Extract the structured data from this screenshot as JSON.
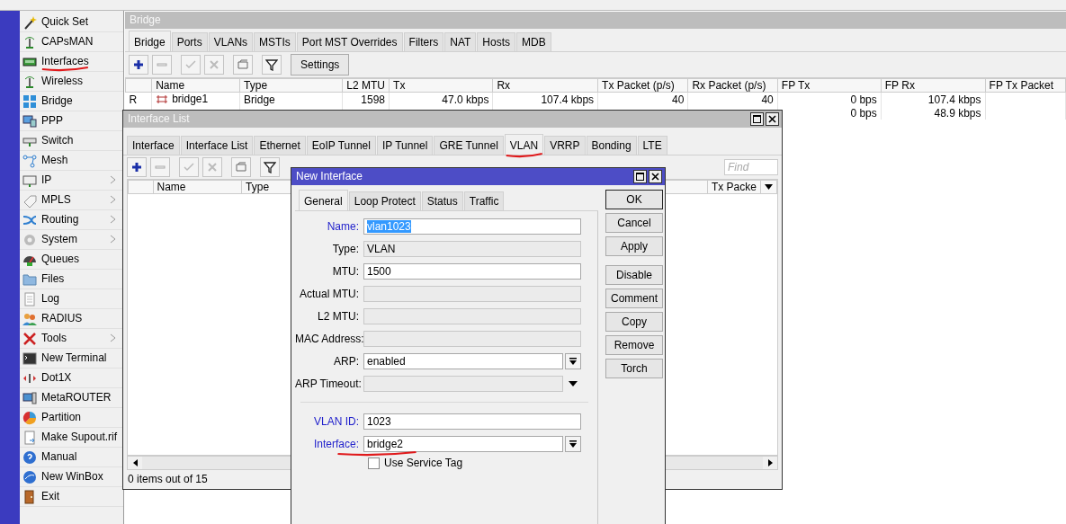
{
  "sidebar": {
    "items": [
      {
        "label": "Quick Set",
        "submenu": false,
        "annotated": false
      },
      {
        "label": "CAPsMAN",
        "submenu": false,
        "annotated": false
      },
      {
        "label": "Interfaces",
        "submenu": false,
        "annotated": true
      },
      {
        "label": "Wireless",
        "submenu": false,
        "annotated": false
      },
      {
        "label": "Bridge",
        "submenu": false,
        "annotated": false
      },
      {
        "label": "PPP",
        "submenu": false,
        "annotated": false
      },
      {
        "label": "Switch",
        "submenu": false,
        "annotated": false
      },
      {
        "label": "Mesh",
        "submenu": false,
        "annotated": false
      },
      {
        "label": "IP",
        "submenu": true,
        "annotated": false
      },
      {
        "label": "MPLS",
        "submenu": true,
        "annotated": false
      },
      {
        "label": "Routing",
        "submenu": true,
        "annotated": false
      },
      {
        "label": "System",
        "submenu": true,
        "annotated": false
      },
      {
        "label": "Queues",
        "submenu": false,
        "annotated": false
      },
      {
        "label": "Files",
        "submenu": false,
        "annotated": false
      },
      {
        "label": "Log",
        "submenu": false,
        "annotated": false
      },
      {
        "label": "RADIUS",
        "submenu": false,
        "annotated": false
      },
      {
        "label": "Tools",
        "submenu": true,
        "annotated": false
      },
      {
        "label": "New Terminal",
        "submenu": false,
        "annotated": false
      },
      {
        "label": "Dot1X",
        "submenu": false,
        "annotated": false
      },
      {
        "label": "MetaROUTER",
        "submenu": false,
        "annotated": false
      },
      {
        "label": "Partition",
        "submenu": false,
        "annotated": false
      },
      {
        "label": "Make Supout.rif",
        "submenu": false,
        "annotated": false
      },
      {
        "label": "Manual",
        "submenu": false,
        "annotated": false
      },
      {
        "label": "New WinBox",
        "submenu": false,
        "annotated": false
      },
      {
        "label": "Exit",
        "submenu": false,
        "annotated": false
      }
    ]
  },
  "bridge_window": {
    "title": "Bridge",
    "tabs": [
      {
        "label": "Bridge",
        "selected": true,
        "annotated": false
      },
      {
        "label": "Ports",
        "selected": false,
        "annotated": false
      },
      {
        "label": "VLANs",
        "selected": false,
        "annotated": false
      },
      {
        "label": "MSTIs",
        "selected": false,
        "annotated": false
      },
      {
        "label": "Port MST Overrides",
        "selected": false,
        "annotated": false
      },
      {
        "label": "Filters",
        "selected": false,
        "annotated": false
      },
      {
        "label": "NAT",
        "selected": false,
        "annotated": false
      },
      {
        "label": "Hosts",
        "selected": false,
        "annotated": false
      },
      {
        "label": "MDB",
        "selected": false,
        "annotated": false
      }
    ],
    "settings_button": "Settings",
    "table": {
      "columns": [
        "Name",
        "Type",
        "L2 MTU",
        "Tx",
        "Rx",
        "Tx Packet (p/s)",
        "Rx Packet (p/s)",
        "FP Tx",
        "FP Rx",
        "FP Tx Packet"
      ],
      "rows": [
        {
          "flag": "R",
          "cells": [
            "bridge1",
            "Bridge",
            "1598",
            "47.0 kbps",
            "107.4 kbps",
            "40",
            "40",
            "0 bps",
            "107.4 kbps",
            null
          ]
        },
        {
          "flag": null,
          "cells": [
            null,
            null,
            null,
            null,
            null,
            null,
            null,
            "0 bps",
            "48.9 kbps",
            null
          ]
        }
      ]
    }
  },
  "interface_list_window": {
    "title": "Interface List",
    "tabs": [
      {
        "label": "Interface",
        "selected": false,
        "annotated": false
      },
      {
        "label": "Interface List",
        "selected": false,
        "annotated": false
      },
      {
        "label": "Ethernet",
        "selected": false,
        "annotated": false
      },
      {
        "label": "EoIP Tunnel",
        "selected": false,
        "annotated": false
      },
      {
        "label": "IP Tunnel",
        "selected": false,
        "annotated": false
      },
      {
        "label": "GRE Tunnel",
        "selected": false,
        "annotated": false
      },
      {
        "label": "VLAN",
        "selected": true,
        "annotated": true
      },
      {
        "label": "VRRP",
        "selected": false,
        "annotated": false
      },
      {
        "label": "Bonding",
        "selected": false,
        "annotated": false
      },
      {
        "label": "LTE",
        "selected": false,
        "annotated": false
      }
    ],
    "find": {
      "placeholder": "Find"
    },
    "table": {
      "columns": [
        "Name",
        "Type",
        "Tx Packe"
      ]
    },
    "status": "0 items out of 15"
  },
  "new_interface_window": {
    "title": "New Interface",
    "tabs": [
      {
        "label": "General",
        "selected": true
      },
      {
        "label": "Loop Protect",
        "selected": false
      },
      {
        "label": "Status",
        "selected": false
      },
      {
        "label": "Traffic",
        "selected": false
      }
    ],
    "fields": [
      {
        "kind": "text",
        "label": "Name:",
        "value": "vlan1023",
        "emphasized": true,
        "disabled": false,
        "value_selected": true,
        "annotated": false
      },
      {
        "kind": "text",
        "label": "Type:",
        "value": "VLAN",
        "emphasized": false,
        "disabled": true,
        "value_selected": false,
        "annotated": false
      },
      {
        "kind": "text",
        "label": "MTU:",
        "value": "1500",
        "emphasized": false,
        "disabled": false,
        "value_selected": false,
        "annotated": false
      },
      {
        "kind": "text",
        "label": "Actual MTU:",
        "emphasized": false,
        "disabled": true,
        "annotated": false
      },
      {
        "kind": "text",
        "label": "L2 MTU:",
        "emphasized": false,
        "disabled": true,
        "annotated": false
      },
      {
        "kind": "text",
        "label": "MAC Address:",
        "emphasized": false,
        "disabled": true,
        "annotated": false
      },
      {
        "kind": "select",
        "label": "ARP:",
        "value": "enabled",
        "emphasized": false,
        "disabled": false,
        "value_selected": false,
        "annotated": false
      },
      {
        "kind": "combo",
        "label": "ARP Timeout:",
        "emphasized": false,
        "disabled": true,
        "annotated": false
      },
      {
        "kind": "separator"
      },
      {
        "kind": "text",
        "label": "VLAN ID:",
        "value": "1023",
        "emphasized": true,
        "disabled": false,
        "value_selected": false,
        "annotated": false
      },
      {
        "kind": "select",
        "label": "Interface:",
        "value": "bridge2",
        "emphasized": true,
        "disabled": false,
        "value_selected": false,
        "annotated": true
      }
    ],
    "checkbox": {
      "label": "Use Service Tag",
      "checked": false
    },
    "button_groups": [
      [
        {
          "label": "OK",
          "default": true
        },
        {
          "label": "Cancel",
          "default": false
        },
        {
          "label": "Apply",
          "default": false
        }
      ],
      [
        {
          "label": "Disable",
          "default": false
        },
        {
          "label": "Comment",
          "default": false
        },
        {
          "label": "Copy",
          "default": false
        },
        {
          "label": "Remove",
          "default": false
        },
        {
          "label": "Torch",
          "default": false
        }
      ]
    ]
  }
}
